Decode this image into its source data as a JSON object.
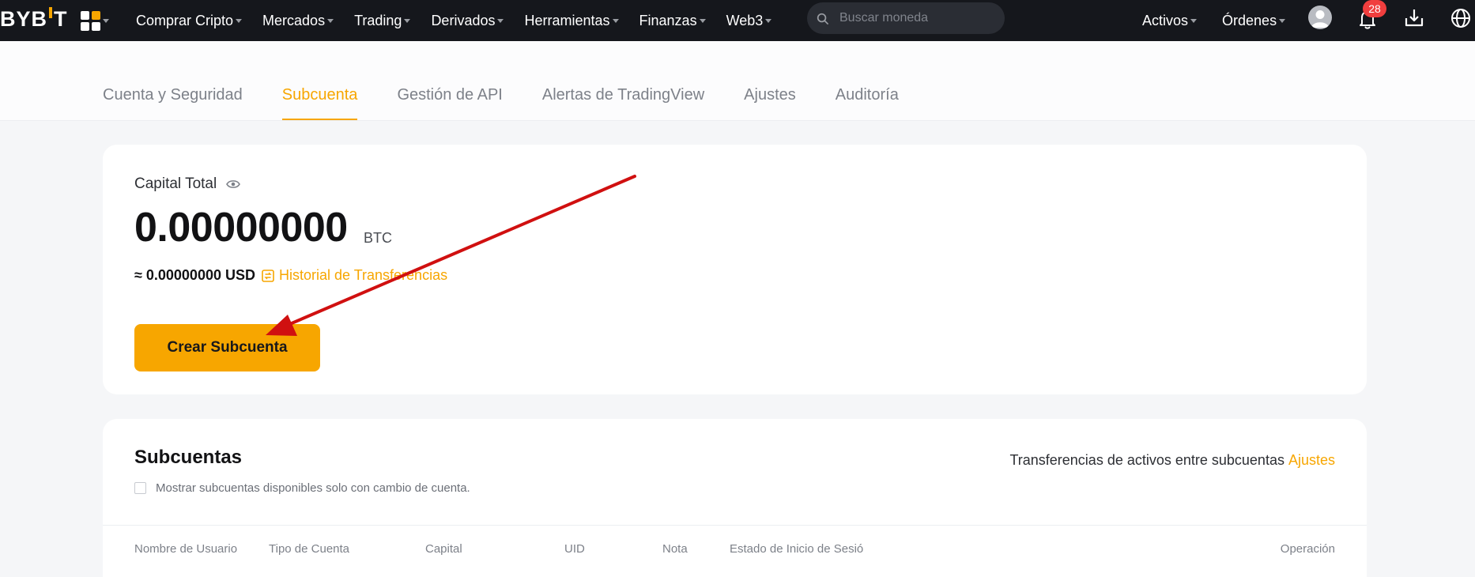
{
  "brand": {
    "logo_left": "BYB",
    "logo_right": "T"
  },
  "nav": {
    "items": [
      "Comprar Cripto",
      "Mercados",
      "Trading",
      "Derivados",
      "Herramientas",
      "Finanzas",
      "Web3"
    ],
    "search_placeholder": "Buscar moneda",
    "right_items": [
      "Activos",
      "Órdenes"
    ],
    "notification_count": "28"
  },
  "tabs": {
    "items": [
      "Cuenta y Seguridad",
      "Subcuenta",
      "Gestión de API",
      "Alertas de TradingView",
      "Ajustes",
      "Auditoría"
    ],
    "active": "Subcuenta"
  },
  "capital": {
    "label": "Capital Total",
    "amount": "0.00000000",
    "unit": "BTC",
    "usd": "≈ 0.00000000 USD",
    "history_link": "Historial de Transferencias",
    "create_button": "Crear Subcuenta"
  },
  "subaccounts": {
    "title": "Subcuentas",
    "transfer_text": "Transferencias de activos entre subcuentas",
    "transfer_link": "Ajustes",
    "checkbox_label": "Mostrar subcuentas disponibles solo con cambio de cuenta.",
    "columns": [
      "Nombre de Usuario",
      "Tipo de Cuenta",
      "Capital",
      "UID",
      "Nota",
      "Estado de Inicio de Sesió",
      "Operación"
    ]
  },
  "colors": {
    "accent": "#f7a600",
    "nav_bg": "#15171c",
    "annotation_arrow": "#d01010"
  }
}
